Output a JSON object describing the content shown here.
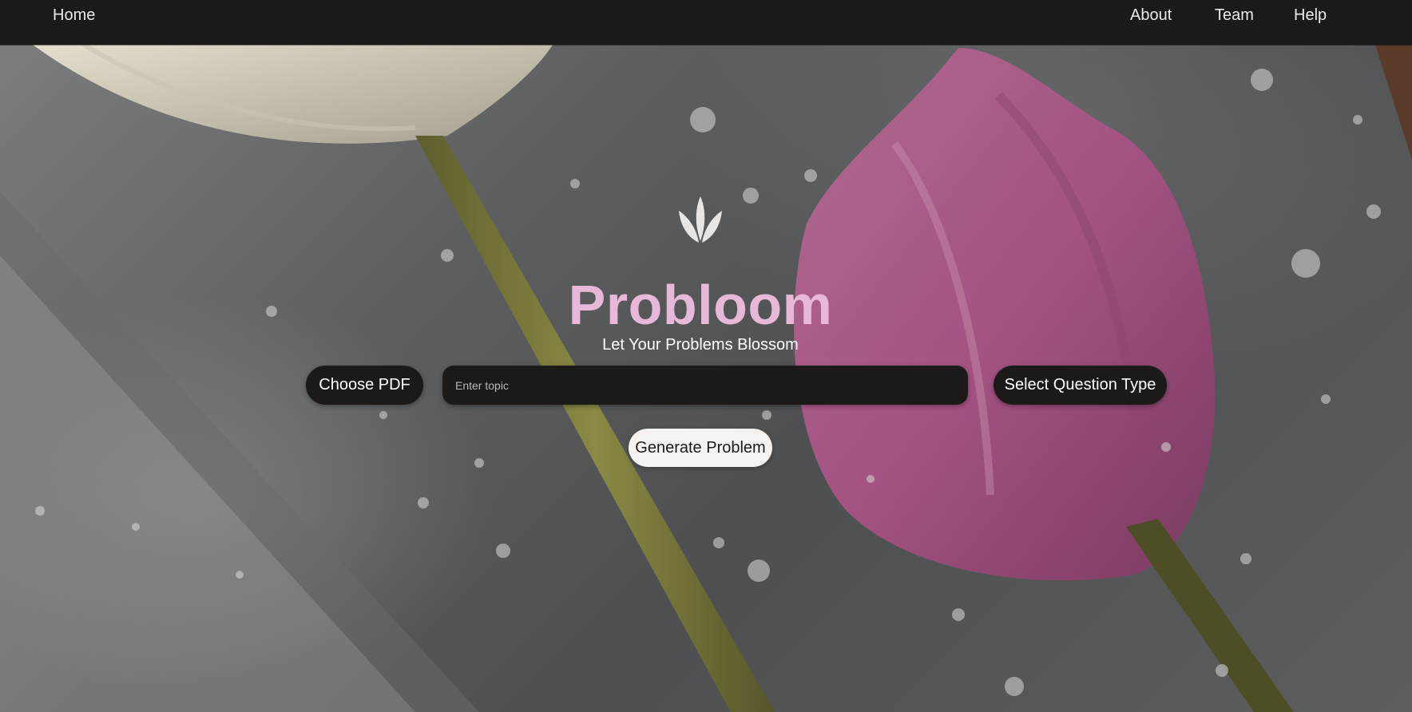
{
  "nav": {
    "home": "Home",
    "about": "About",
    "team": "Team",
    "help": "Help"
  },
  "hero": {
    "logo_icon": "flower-bud-icon",
    "title": "Probloom",
    "subtitle": "Let Your Problems Blossom"
  },
  "controls": {
    "choose_pdf": "Choose PDF",
    "topic_placeholder": "Enter topic",
    "topic_value": "",
    "select_question_type": "Select Question Type",
    "generate": "Generate Problem"
  },
  "colors": {
    "navbar": "#1a1a1a",
    "title": "#e7b8d8",
    "control_bg": "#1c1a19",
    "generate_bg": "#f6f2f0"
  }
}
